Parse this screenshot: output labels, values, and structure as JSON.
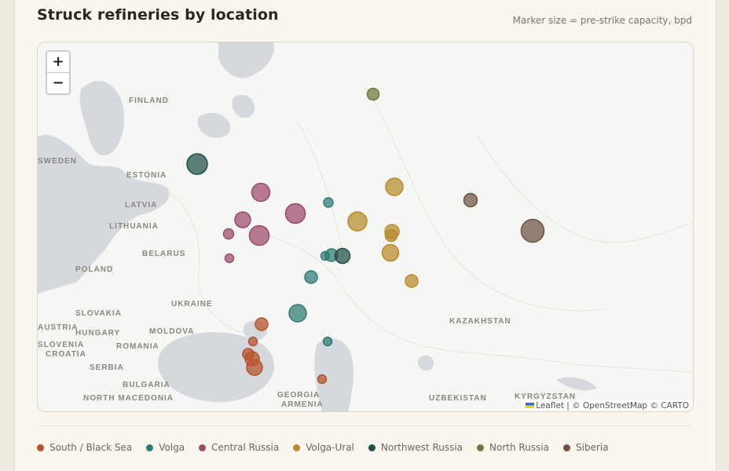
{
  "page": {
    "title": "Struck refineries by location",
    "note": "Marker size = pre-strike capacity, bpd"
  },
  "map": {
    "zoom_in": "+",
    "zoom_out": "−",
    "attribution": "Leaflet | © OpenStreetMap © CARTO",
    "place_labels": [
      "FINLAND",
      "SWEDEN",
      "ESTONIA",
      "LATVIA",
      "LITHUANIA",
      "BELARUS",
      "POLAND",
      "UKRAINE",
      "SLOVAKIA",
      "HUNGARY",
      "MOLDOVA",
      "AUSTRIA",
      "SLOVENIA",
      "CROATIA",
      "ROMANIA",
      "SERBIA",
      "BULGARIA",
      "NORTH MACEDONIA",
      "GEORGIA",
      "ARMENIA",
      "KAZAKHSTAN",
      "UZBEKISTAN",
      "KYRGYZSTAN"
    ]
  },
  "legend": [
    {
      "label": "South / Black Sea",
      "color": "#b4532a"
    },
    {
      "label": "Volga",
      "color": "#2f7a76"
    },
    {
      "label": "Central Russia",
      "color": "#9a4a6c"
    },
    {
      "label": "Volga-Ural",
      "color": "#b58a2a"
    },
    {
      "label": "Northwest Russia",
      "color": "#1f5048"
    },
    {
      "label": "North Russia",
      "color": "#6b7a3a"
    },
    {
      "label": "Siberia",
      "color": "#6e5142"
    }
  ]
}
